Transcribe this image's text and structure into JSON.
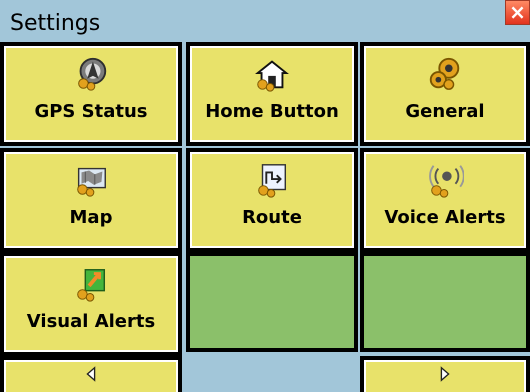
{
  "window": {
    "title": "Settings",
    "close_label": "×"
  },
  "tiles": [
    {
      "label": "GPS Status",
      "icon": "gps-status-icon"
    },
    {
      "label": "Home Button",
      "icon": "home-button-icon"
    },
    {
      "label": "General",
      "icon": "general-icon"
    },
    {
      "label": "Map",
      "icon": "map-icon"
    },
    {
      "label": "Route",
      "icon": "route-icon"
    },
    {
      "label": "Voice Alerts",
      "icon": "voice-alerts-icon"
    },
    {
      "label": "Visual Alerts",
      "icon": "visual-alerts-icon"
    }
  ],
  "navigation": {
    "previous_icon": "left-arrow-icon",
    "next_icon": "right-arrow-icon"
  },
  "colors": {
    "background": "#a2c6d9",
    "tile": "#e8e26a",
    "empty_tile": "#8bc06a"
  }
}
